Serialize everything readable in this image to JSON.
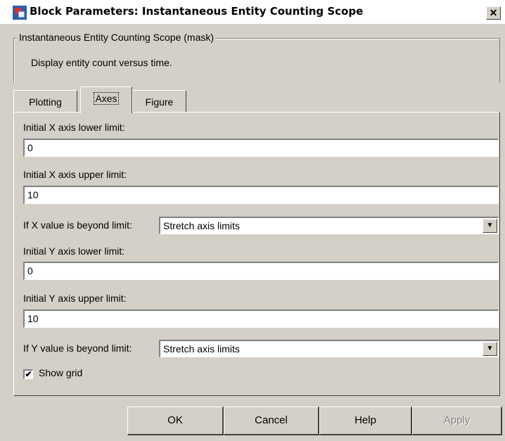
{
  "window": {
    "title": "Block Parameters: Instantaneous Entity Counting Scope",
    "close_glyph": "✕"
  },
  "mask": {
    "legend": "Instantaneous Entity Counting Scope (mask)",
    "description": "Display entity count versus time."
  },
  "tabs": [
    {
      "label": "Plotting",
      "active": false
    },
    {
      "label": "Axes",
      "active": true
    },
    {
      "label": "Figure",
      "active": false
    }
  ],
  "fields": {
    "x_lower_label": "Initial X axis lower limit:",
    "x_lower_value": "0",
    "x_upper_label": "Initial X axis upper limit:",
    "x_upper_value": "10",
    "x_beyond_label": "If X value is beyond limit:",
    "x_beyond_value": "Stretch axis limits",
    "y_lower_label": "Initial Y axis lower limit:",
    "y_lower_value": "0",
    "y_upper_label": "Initial Y axis upper limit:",
    "y_upper_value": "10",
    "y_beyond_label": "If Y value is beyond limit:",
    "y_beyond_value": "Stretch axis limits"
  },
  "show_grid": {
    "label": "Show grid",
    "checked": true,
    "glyph": "✔"
  },
  "buttons": {
    "ok": "OK",
    "cancel": "Cancel",
    "help": "Help",
    "apply": "Apply"
  }
}
